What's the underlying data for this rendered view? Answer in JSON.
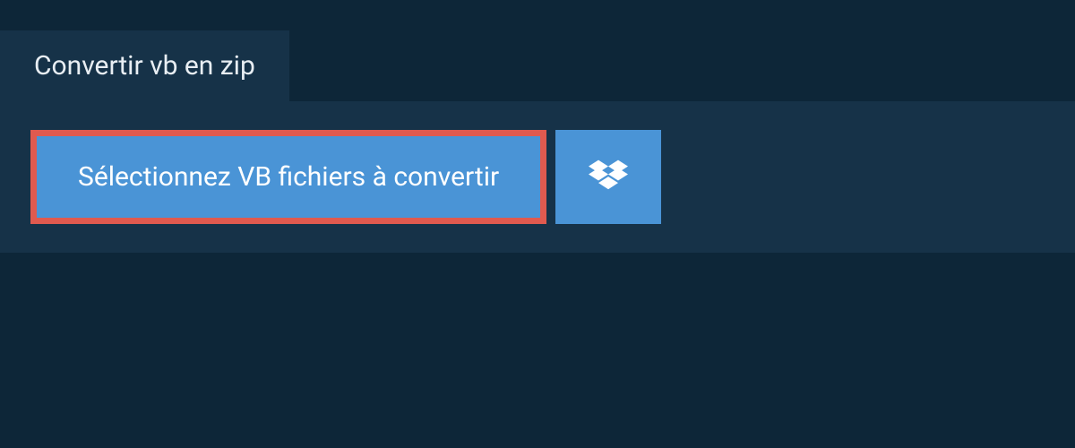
{
  "tab": {
    "title": "Convertir vb en zip"
  },
  "actions": {
    "select_files_label": "Sélectionnez VB fichiers à convertir"
  },
  "colors": {
    "background": "#0d2638",
    "panel": "#163248",
    "button": "#4a94d6",
    "highlight_border": "#e05a4f"
  }
}
